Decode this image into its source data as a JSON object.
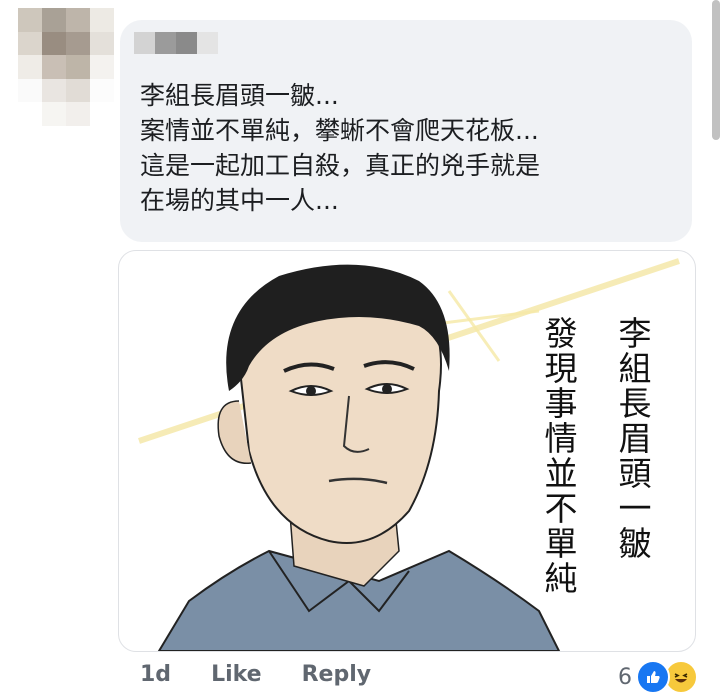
{
  "comment": {
    "lines": [
      "李組長眉頭一皺...",
      "案情並不單純，攀蜥不會爬天花板...",
      "這是一起加工自殺，真正的兇手就是",
      "在場的其中一人..."
    ]
  },
  "meme": {
    "text_right": "李組長眉頭一皺",
    "text_left": "發現事情並不單純"
  },
  "actions": {
    "time": "1d",
    "like": "Like",
    "reply": "Reply"
  },
  "reactions": {
    "count": "6",
    "icons": [
      "like-icon",
      "haha-icon"
    ]
  },
  "colors": {
    "bubble": "#f0f2f5",
    "text": "#1c1e21",
    "meta": "#606770",
    "like_blue": "#1877f2",
    "haha_yellow": "#f7c93c"
  }
}
